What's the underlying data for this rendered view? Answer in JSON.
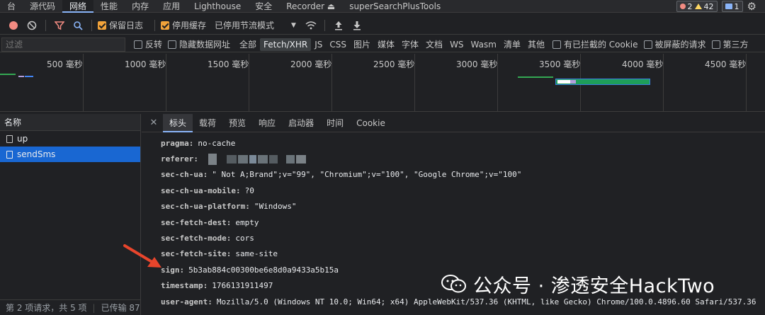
{
  "top_tabs": [
    "台",
    "源代码",
    "网络",
    "性能",
    "内存",
    "应用",
    "Lighthouse",
    "安全",
    "Recorder ⏏",
    "superSearchPlusTools"
  ],
  "badges": {
    "errors": "2",
    "warnings": "42",
    "messages": "1"
  },
  "toolbar": {
    "preserve_log": "保留日志",
    "disable_cache": "停用缓存",
    "throttle": "已停用节流模式"
  },
  "filter": {
    "placeholder": "过滤",
    "invert": "反转",
    "hide_data_urls": "隐藏数据网址",
    "types": [
      "全部",
      "Fetch/XHR",
      "JS",
      "CSS",
      "图片",
      "媒体",
      "字体",
      "文档",
      "WS",
      "Wasm",
      "清单",
      "其他"
    ],
    "blocked_cookies": "有已拦截的 Cookie",
    "blocked_requests": "被屏蔽的请求",
    "third_party": "第三方"
  },
  "timeline_ticks": [
    "500 毫秒",
    "1000 毫秒",
    "1500 毫秒",
    "2000 毫秒",
    "2500 毫秒",
    "3000 毫秒",
    "3500 毫秒",
    "4000 毫秒",
    "4500 毫秒"
  ],
  "left": {
    "header": "名称",
    "requests": [
      "up",
      "sendSms"
    ],
    "status": "第 2 项请求，共 5 项",
    "transferred": "已传输 87"
  },
  "detail_tabs": [
    "标头",
    "载荷",
    "预览",
    "响应",
    "启动器",
    "时间",
    "Cookie"
  ],
  "headers": [
    {
      "k": "pragma:",
      "v": "no-cache"
    },
    {
      "k": "referer:",
      "v": ""
    },
    {
      "k": "sec-ch-ua:",
      "v": "\" Not A;Brand\";v=\"99\", \"Chromium\";v=\"100\", \"Google Chrome\";v=\"100\""
    },
    {
      "k": "sec-ch-ua-mobile:",
      "v": "?0"
    },
    {
      "k": "sec-ch-ua-platform:",
      "v": "\"Windows\""
    },
    {
      "k": "sec-fetch-dest:",
      "v": "empty"
    },
    {
      "k": "sec-fetch-mode:",
      "v": "cors"
    },
    {
      "k": "sec-fetch-site:",
      "v": "same-site"
    },
    {
      "k": "sign:",
      "v": "5b3ab884c00300be6e8d0a9433a5b15a"
    },
    {
      "k": "timestamp:",
      "v": "1766131911497"
    },
    {
      "k": "user-agent:",
      "v": "Mozilla/5.0 (Windows NT 10.0; Win64; x64) AppleWebKit/537.36 (KHTML, like Gecko) Chrome/100.0.4896.60 Safari/537.36"
    }
  ],
  "watermark": "公众号 · 渗透安全HackTwo",
  "colors": {
    "accent": "#8ab4f8",
    "selected": "#1967d2",
    "arrow": "#e8452c",
    "checkbox": "#f2a33a"
  }
}
